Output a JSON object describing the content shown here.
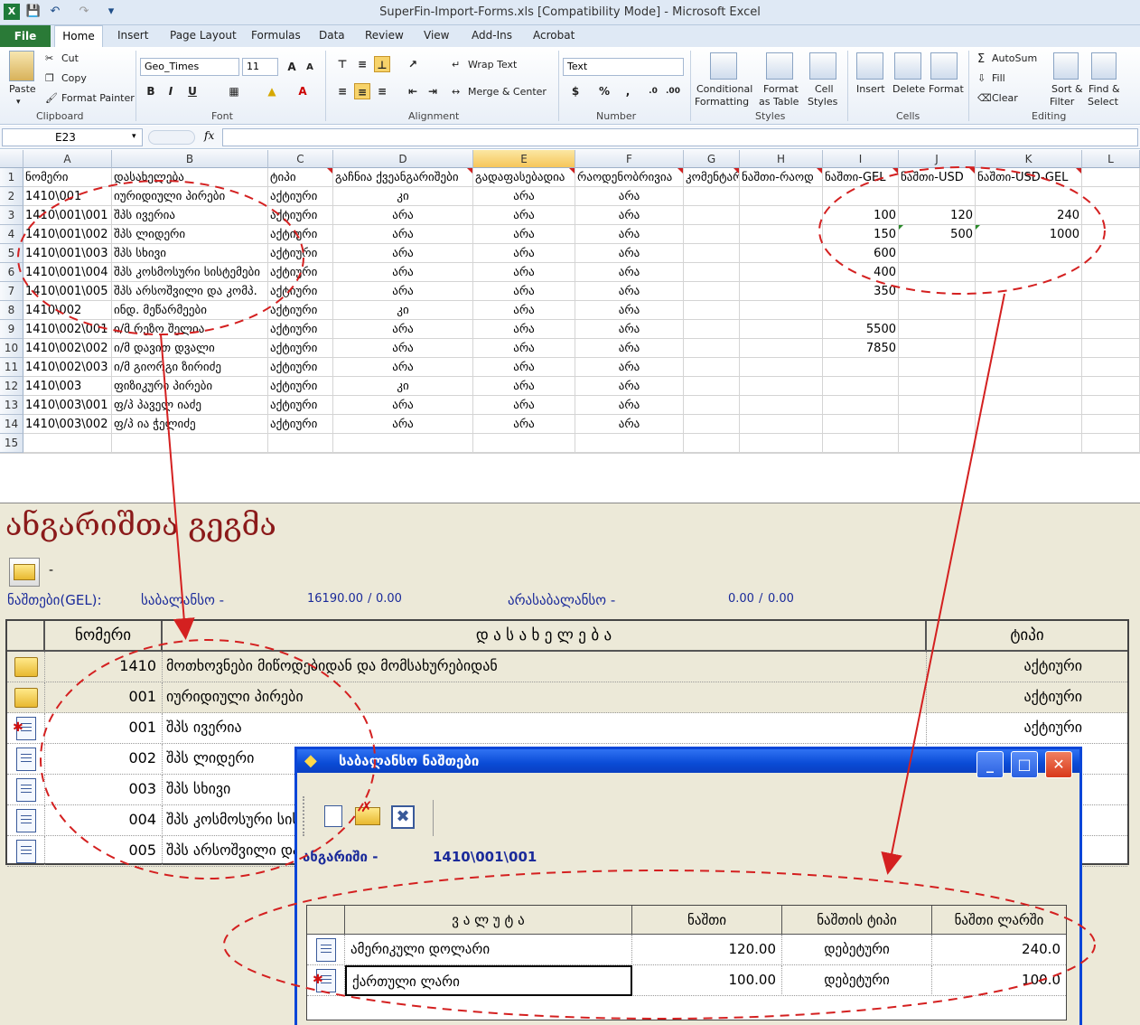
{
  "excel": {
    "title": "SuperFin-Import-Forms.xls  [Compatibility Mode]  -  Microsoft Excel",
    "tabs": [
      "File",
      "Home",
      "Insert",
      "Page Layout",
      "Formulas",
      "Data",
      "Review",
      "View",
      "Add-Ins",
      "Acrobat"
    ],
    "ribbon": {
      "paste": "Paste",
      "cut": "Cut",
      "copy": "Copy",
      "format_painter": "Format Painter",
      "font_name": "Geo_Times",
      "font_size": "11",
      "wrap_text": "Wrap Text",
      "merge_center": "Merge & Center",
      "number_format": "Text",
      "conditional_formatting": [
        "Conditional",
        "Formatting"
      ],
      "format_as_table": [
        "Format",
        "as Table"
      ],
      "cell_styles": [
        "Cell",
        "Styles"
      ],
      "insert": "Insert",
      "delete": "Delete",
      "format": "Format",
      "autosum": "AutoSum",
      "fill": "Fill",
      "clear": "Clear",
      "sort_filter": [
        "Sort &",
        "Filter"
      ],
      "find_select": [
        "Find &",
        "Select"
      ],
      "groups": [
        "Clipboard",
        "Font",
        "Alignment",
        "Number",
        "Styles",
        "Cells",
        "Editing"
      ]
    },
    "name_box": "E23",
    "fx": "fx",
    "columns": [
      "A",
      "B",
      "C",
      "D",
      "E",
      "F",
      "G",
      "H",
      "I",
      "J",
      "K",
      "L"
    ],
    "rows": [
      [
        "ნომერი",
        "დასახელება",
        "ტიპი",
        "გაჩნია ქვეანგარიშები",
        "გადაფასებადია",
        "რაოდენობრივია",
        "კომენტარი",
        "ნაშთი-რაოდ",
        "ნაშთი-GEL",
        "ნაშთი-USD",
        "ნაშთი-USD-GEL",
        ""
      ],
      [
        "1410\\001",
        "იურიდიული პირები",
        "აქტიური",
        "კი",
        "არა",
        "არა",
        "",
        "",
        "",
        "",
        "",
        ""
      ],
      [
        "1410\\001\\001",
        "შპს ივერია",
        "აქტიური",
        "არა",
        "არა",
        "არა",
        "",
        "",
        "100",
        "120",
        "240",
        ""
      ],
      [
        "1410\\001\\002",
        "შპს ლიდერი",
        "აქტიური",
        "არა",
        "არა",
        "არა",
        "",
        "",
        "150",
        "500",
        "1000",
        ""
      ],
      [
        "1410\\001\\003",
        "შპს სხივი",
        "აქტიური",
        "არა",
        "არა",
        "არა",
        "",
        "",
        "600",
        "",
        "",
        ""
      ],
      [
        "1410\\001\\004",
        "შპს კოსმოსური სისტემები",
        "აქტიური",
        "არა",
        "არა",
        "არა",
        "",
        "",
        "400",
        "",
        "",
        ""
      ],
      [
        "1410\\001\\005",
        "შპს არსოშვილი და კომპ.",
        "აქტიური",
        "არა",
        "არა",
        "არა",
        "",
        "",
        "350",
        "",
        "",
        ""
      ],
      [
        "1410\\002",
        "ინდ. მეწარმეები",
        "აქტიური",
        "კი",
        "არა",
        "არა",
        "",
        "",
        "",
        "",
        "",
        ""
      ],
      [
        "1410\\002\\001",
        "ი/მ რეზო შელია",
        "აქტიური",
        "არა",
        "არა",
        "არა",
        "",
        "",
        "5500",
        "",
        "",
        ""
      ],
      [
        "1410\\002\\002",
        "ი/მ დავით დვალი",
        "აქტიური",
        "არა",
        "არა",
        "არა",
        "",
        "",
        "7850",
        "",
        "",
        ""
      ],
      [
        "1410\\002\\003",
        "ი/მ გიორგი ზირიძე",
        "აქტიური",
        "არა",
        "არა",
        "არა",
        "",
        "",
        "",
        "",
        "",
        ""
      ],
      [
        "1410\\003",
        "ფიზიკური პირები",
        "აქტიური",
        "კი",
        "არა",
        "არა",
        "",
        "",
        "",
        "",
        "",
        ""
      ],
      [
        "1410\\003\\001",
        "ფ/პ პაველ იაძე",
        "აქტიური",
        "არა",
        "არა",
        "არა",
        "",
        "",
        "",
        "",
        "",
        ""
      ],
      [
        "1410\\003\\002",
        "ფ/პ ია ჭელიძე",
        "აქტიური",
        "არა",
        "არა",
        "არა",
        "",
        "",
        "",
        "",
        "",
        ""
      ],
      [
        "",
        "",
        "",
        "",
        "",
        "",
        "",
        "",
        "",
        "",
        "",
        ""
      ]
    ]
  },
  "app": {
    "title": "ანგარიშთა გეგმა",
    "dash": "-",
    "balances_label": "ნაშთები(GEL):",
    "balance_label": "საბალანსო -",
    "balance_value": "16190.00",
    "balance_value2": "0.00",
    "offbalance_label": "არასაბალანსო -",
    "offbalance_value": "0.00",
    "offbalance_value2": "0.00",
    "slash": "/",
    "headers": [
      "ნომერი",
      "დ ა ს ა ხ ე ლ ე ბ ა",
      "ტიპი"
    ],
    "rows": [
      {
        "num": "1410",
        "name": "მოთხოვნები მიწოდებიდან და მომსახურებიდან",
        "type": "აქტიური",
        "icon": "folder"
      },
      {
        "num": "001",
        "name": "იურიდიული პირები",
        "type": "აქტიური",
        "icon": "folder-open"
      },
      {
        "num": "001",
        "name": "შპს ივერია",
        "type": "აქტიური",
        "icon": "doc-new"
      },
      {
        "num": "002",
        "name": "შპს ლიდერი",
        "type": "",
        "icon": "doc"
      },
      {
        "num": "003",
        "name": "შპს სხივი",
        "type": "",
        "icon": "doc"
      },
      {
        "num": "004",
        "name": "შპს კოსმოსური სისტემები",
        "type": "",
        "icon": "doc"
      },
      {
        "num": "005",
        "name": "შპს არსოშვილი და კომპ.",
        "type": "",
        "icon": "doc"
      }
    ]
  },
  "dialog": {
    "title": "საბალანსო ნაშთები",
    "account_label": "ანგარიში -",
    "account_value": "1410\\001\\001",
    "headers": [
      "ვ ა ლ უ ტ ა",
      "ნაშთი",
      "ნაშთის ტიპი",
      "ნაშთი ლარში"
    ],
    "rows": [
      {
        "currency": "ამერიკული დოლარი",
        "balance": "120.00",
        "type": "დებეტური",
        "gel": "240.0"
      },
      {
        "currency": "ქართული ლარი",
        "balance": "100.00",
        "type": "დებეტური",
        "gel": "100.0"
      }
    ],
    "min": "_",
    "max": "□",
    "close": "✕"
  }
}
